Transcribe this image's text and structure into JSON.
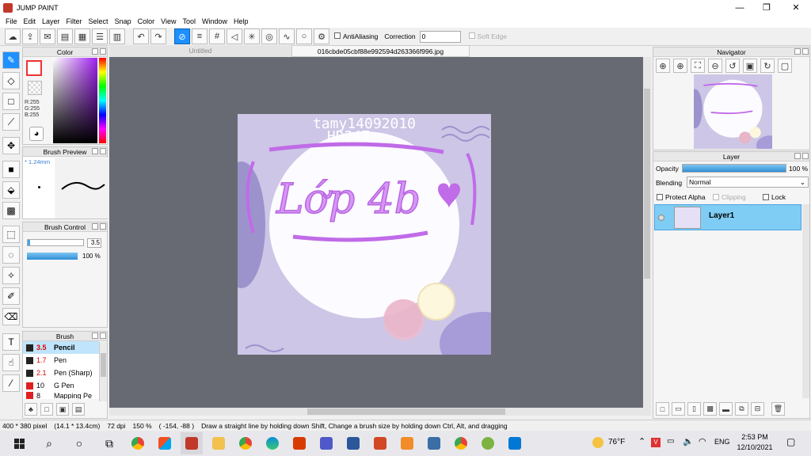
{
  "app": {
    "title": "JUMP PAINT"
  },
  "window_controls": {
    "minimize": "—",
    "restore": "❐",
    "close": "✕"
  },
  "menu": [
    "File",
    "Edit",
    "Layer",
    "Filter",
    "Select",
    "Snap",
    "Color",
    "View",
    "Tool",
    "Window",
    "Help"
  ],
  "toolbar": {
    "antialiasing_label": "AntiAliasing",
    "correction_label": "Correction",
    "correction_value": "0",
    "soft_edge_label": "Soft Edge"
  },
  "tabs": {
    "untitled": "Untitled",
    "file": "016cbde05cbf88e992594d263366f996.jpg"
  },
  "color_panel": {
    "title": "Color",
    "r": "R:255",
    "g": "G:255",
    "b": "B:255",
    "primary": "#ffffff",
    "secondary": "#ff0000"
  },
  "brush_preview": {
    "title": "Brush Preview",
    "size": "* 1.24mm"
  },
  "brush_control": {
    "title": "Brush Control",
    "size_value": "3.5",
    "opacity_value": "100 %"
  },
  "brush_panel": {
    "title": "Brush",
    "items": [
      {
        "size": "3.5",
        "name": "Pencil",
        "swatch": "#222222",
        "selected": true
      },
      {
        "size": "1.7",
        "name": "Pen",
        "swatch": "#222222"
      },
      {
        "size": "2.1",
        "name": "Pen (Sharp)",
        "swatch": "#222222"
      },
      {
        "size": "10",
        "name": "G Pen",
        "swatch": "#e02020"
      },
      {
        "size": "8",
        "name": "Mapping Pe",
        "swatch": "#e02020"
      }
    ]
  },
  "navigator": {
    "title": "Navigator"
  },
  "layer_panel": {
    "title": "Layer",
    "opacity_label": "Opacity",
    "opacity_value": "100 %",
    "blending_label": "Blending",
    "blending_value": "Normal",
    "protect_alpha": "Protect Alpha",
    "clipping": "Clipping",
    "lock": "Lock",
    "layers": [
      {
        "name": "Layer1"
      }
    ]
  },
  "artwork": {
    "watermark_line1": "tamy14092010",
    "watermark_line2": "HD247",
    "title_text": "Lớp 4b"
  },
  "status": {
    "dimensions": "400 * 380 pixel",
    "physical": "(14.1 * 13.4cm)",
    "dpi": "72 dpi",
    "zoom": "150 %",
    "cursor": "( -154, -88 )",
    "hint": "Draw a straight line by holding down Shift, Change a brush size by holding down Ctrl, Alt, and dragging"
  },
  "taskbar": {
    "weather": "76°F",
    "language": "ENG",
    "time": "2:53 PM",
    "date": "12/10/2021"
  }
}
